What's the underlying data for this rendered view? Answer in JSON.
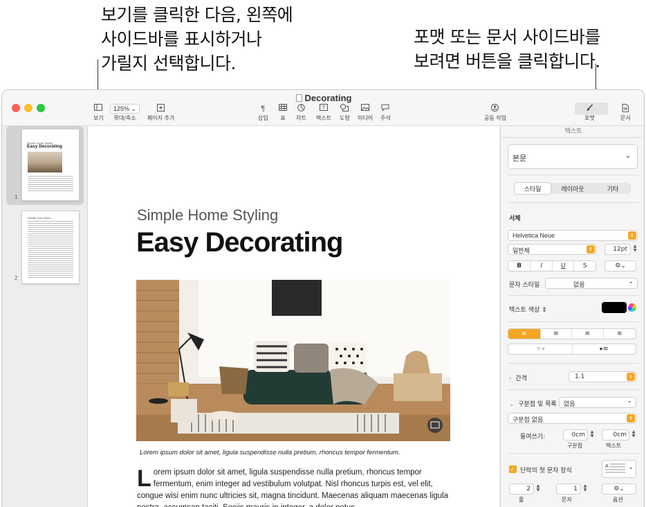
{
  "callouts": {
    "left": "보기를 클릭한 다음, 왼쪽에\n사이드바를 표시하거나\n가릴지 선택합니다.",
    "right": "포맷 또는 문서 사이드바를\n보려면 버튼을 클릭합니다."
  },
  "window": {
    "title": "Decorating",
    "colors": {
      "close": "#ff5f57",
      "minimize": "#febc2e",
      "zoom": "#28c840",
      "accent": "#f5a623"
    }
  },
  "toolbar": {
    "view": {
      "label": "보기",
      "icon": "sidebar-icon"
    },
    "zoom": {
      "value": "125%",
      "label": "확대/축소",
      "icon": "chevron-down-icon"
    },
    "add_page": {
      "label": "페이지 추가",
      "icon": "plus-square-icon"
    },
    "insert": {
      "label": "삽입",
      "icon": "paragraph-icon"
    },
    "table": {
      "label": "표",
      "icon": "table-icon"
    },
    "chart": {
      "label": "차트",
      "icon": "chart-icon"
    },
    "text": {
      "label": "텍스트",
      "icon": "textbox-icon"
    },
    "shape": {
      "label": "도형",
      "icon": "shape-icon"
    },
    "media": {
      "label": "미디어",
      "icon": "image-icon"
    },
    "comment": {
      "label": "주석",
      "icon": "comment-icon"
    },
    "collaborate": {
      "label": "공동 작업",
      "icon": "collaborate-icon"
    },
    "format": {
      "label": "포맷",
      "icon": "paintbrush-icon"
    },
    "document": {
      "label": "문서",
      "icon": "document-icon"
    }
  },
  "sidebar": {
    "pages": [
      {
        "number": "1",
        "subtitle": "Simple Home Styling",
        "title": "Easy Decorating"
      },
      {
        "number": "2",
        "subtitle": "Climate Quiz Notes"
      }
    ]
  },
  "document": {
    "subtitle": "Simple Home Styling",
    "title": "Easy Decorating",
    "caption": "Lorem ipsum dolor sit amet, ligula suspendisse nulla pretium, rhoncus tempor fermentum.",
    "drop_cap": "L",
    "body": "orem ipsum dolor sit amet, ligula suspendisse nulla pretium, rhoncus tempor fermentum, enim integer ad vestibulum volutpat. Nisl rhoncus turpis est, vel elit, congue wisi enim nunc ultricies sit, magna tincidunt. Maecenas aliquam maecenas ligula nostra, accumsan taciti. Sociis mauris in integer, a dolor netus"
  },
  "inspector": {
    "header": "텍스트",
    "paragraph_style": "본문",
    "tabs": [
      "스타일",
      "레이아웃",
      "기타"
    ],
    "font_section": "서체",
    "font_name": "Helvetica Neue",
    "font_weight": "일반체",
    "font_size": "12pt",
    "format_buttons": [
      "B",
      "I",
      "U",
      "S"
    ],
    "char_style_label": "문자 스타일",
    "char_style_value": "없음",
    "text_color_label": "텍스트 색상",
    "text_color": "#000000",
    "spacing_label": "간격",
    "spacing_value": "1.1",
    "bullets_label": "구분점 및 목록",
    "bullets_value": "없음",
    "bullet_type": "구분점 없음",
    "indent_label": "들여쓰기:",
    "indent_bullet": "0cm",
    "indent_text": "0cm",
    "indent_bullet_label": "구분점",
    "indent_text_label": "텍스트",
    "dropcap_label": "단락의 첫 문자 장식",
    "dropcap_checked": true,
    "lines_value": "2",
    "chars_value": "1",
    "lines_label": "줄",
    "chars_label": "문자",
    "options_label": "옵션"
  }
}
